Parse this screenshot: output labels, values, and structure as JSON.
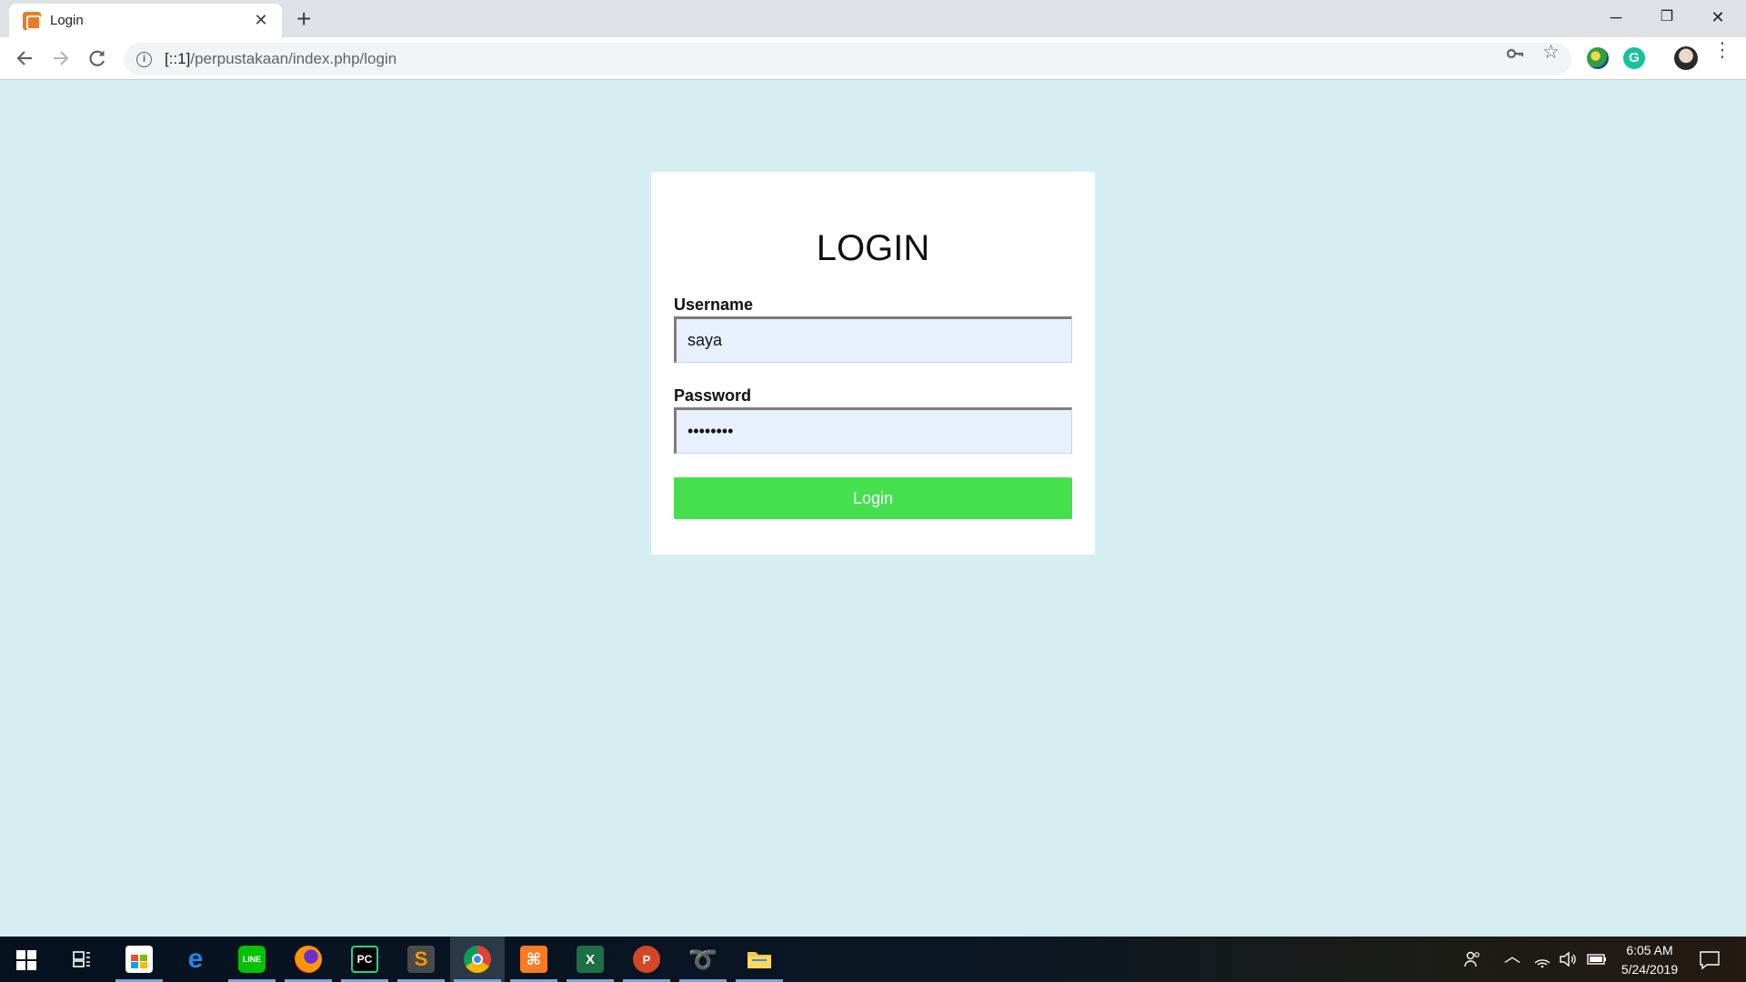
{
  "browser": {
    "tab_title": "Login",
    "tab_close": "✕",
    "new_tab": "+",
    "url_host": "[::1]",
    "url_path": "/perpustakaan/index.php/login",
    "window_controls": {
      "minimize": "─",
      "restore": "❐",
      "close": "✕"
    },
    "icons": [
      "back-icon",
      "forward-icon",
      "reload-icon",
      "info-icon",
      "key-icon",
      "star-icon",
      "extension-globe-icon",
      "grammarly-icon",
      "profile-avatar",
      "menu-icon"
    ],
    "grammarly_letter": "G"
  },
  "login": {
    "title": "LOGIN",
    "username_label": "Username",
    "username_value": "saya",
    "password_label": "Password",
    "password_value": "••••••••",
    "button_label": "Login"
  },
  "colors": {
    "page_bg": "#d4eef2",
    "input_bg": "#e8f0fe",
    "button_bg": "#46e04f"
  },
  "taskbar": {
    "apps": [
      "Microsoft Store",
      "Microsoft Edge",
      "LINE",
      "Firefox",
      "PyCharm",
      "Sublime Text",
      "Google Chrome",
      "XAMPP",
      "Excel",
      "PowerPoint",
      "Dolphin",
      "File Explorer"
    ],
    "time": "6:05 AM",
    "date": "5/24/2019"
  }
}
